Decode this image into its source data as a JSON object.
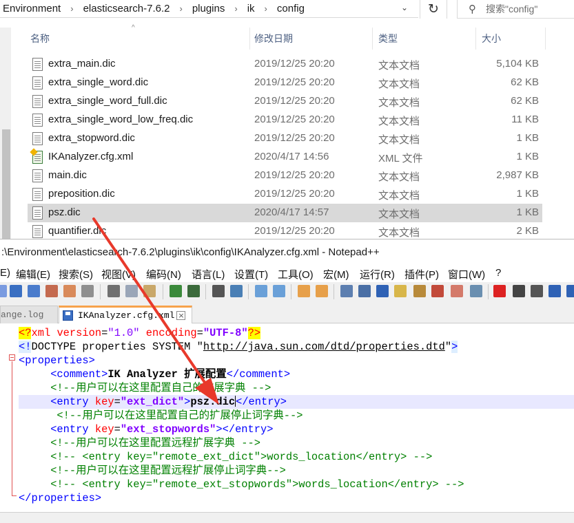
{
  "explorer": {
    "breadcrumbs": [
      "Environment",
      "elasticsearch-7.6.2",
      "plugins",
      "ik",
      "config"
    ],
    "search_placeholder": "搜索\"config\"",
    "columns": {
      "name": "名称",
      "date": "修改日期",
      "type": "类型",
      "size": "大小"
    },
    "files": [
      {
        "name": "extra_main.dic",
        "date": "2019/12/25 20:20",
        "type": "文本文档",
        "size": "5,104 KB",
        "icon": "text-file-icon"
      },
      {
        "name": "extra_single_word.dic",
        "date": "2019/12/25 20:20",
        "type": "文本文档",
        "size": "62 KB",
        "icon": "text-file-icon"
      },
      {
        "name": "extra_single_word_full.dic",
        "date": "2019/12/25 20:20",
        "type": "文本文档",
        "size": "62 KB",
        "icon": "text-file-icon"
      },
      {
        "name": "extra_single_word_low_freq.dic",
        "date": "2019/12/25 20:20",
        "type": "文本文档",
        "size": "11 KB",
        "icon": "text-file-icon"
      },
      {
        "name": "extra_stopword.dic",
        "date": "2019/12/25 20:20",
        "type": "文本文档",
        "size": "1 KB",
        "icon": "text-file-icon"
      },
      {
        "name": "IKAnalyzer.cfg.xml",
        "date": "2020/4/17 14:56",
        "type": "XML 文件",
        "size": "1 KB",
        "icon": "xml-file-icon"
      },
      {
        "name": "main.dic",
        "date": "2019/12/25 20:20",
        "type": "文本文档",
        "size": "2,987 KB",
        "icon": "text-file-icon"
      },
      {
        "name": "preposition.dic",
        "date": "2019/12/25 20:20",
        "type": "文本文档",
        "size": "1 KB",
        "icon": "text-file-icon"
      },
      {
        "name": "psz.dic",
        "date": "2020/4/17 14:57",
        "type": "文本文档",
        "size": "1 KB",
        "icon": "text-file-icon",
        "selected": true
      },
      {
        "name": "quantifier.dic",
        "date": "2019/12/25 20:20",
        "type": "文本文档",
        "size": "2 KB",
        "icon": "text-file-icon"
      }
    ]
  },
  "npp": {
    "title": ":\\Environment\\elasticsearch-7.6.2\\plugins\\ik\\config\\IKAnalyzer.cfg.xml - Notepad++",
    "menu": [
      "E)",
      "编辑(E)",
      "搜索(S)",
      "视图(V)",
      "编码(N)",
      "语言(L)",
      "设置(T)",
      "工具(O)",
      "宏(M)",
      "运行(R)",
      "插件(P)",
      "窗口(W)",
      "?"
    ],
    "tabs": [
      {
        "label": "ange.log",
        "active": false
      },
      {
        "label": "IKAnalyzer.cfg.xml",
        "active": true
      }
    ],
    "code": {
      "l1": {
        "a": "<?",
        "b": "xml ",
        "c": "version",
        "d": "=",
        "e": "\"1.0\"",
        "f": " ",
        "g": "encoding",
        "h": "=",
        "i": "\"UTF-8\"",
        "j": "?>"
      },
      "l2": {
        "a": "<!",
        "b": "DOCTYPE properties SYSTEM \"",
        "c": "http://java.sun.com/dtd/properties.dtd",
        "d": "\"",
        "e": ">"
      },
      "l3": {
        "a": "<properties>"
      },
      "l4": {
        "indent": "     ",
        "a": "<comment>",
        "b": "IK Analyzer 扩展配置",
        "c": "</comment>"
      },
      "l5": {
        "indent": "     ",
        "a": "<!--用户可以在这里配置自己的扩展字典 -->"
      },
      "l6": {
        "indent": "     ",
        "a": "<entry ",
        "b": "key",
        "c": "=",
        "d": "\"ext_dict\"",
        "e": ">",
        "f": "psz.dic",
        "g": "</entry>"
      },
      "l7": {
        "indent": "      ",
        "a": "<!--用户可以在这里配置自己的扩展停止词字典-->"
      },
      "l8": {
        "indent": "     ",
        "a": "<entry ",
        "b": "key",
        "c": "=",
        "d": "\"ext_stopwords\"",
        "e": "></entry>"
      },
      "l9": {
        "indent": "     ",
        "a": "<!--用户可以在这里配置远程扩展字典 -->"
      },
      "l10": {
        "indent": "     ",
        "a": "<!-- <entry key=\"remote_ext_dict\">words_location</entry> -->"
      },
      "l11": {
        "indent": "     ",
        "a": "<!--用户可以在这里配置远程扩展停止词字典-->"
      },
      "l12": {
        "indent": "     ",
        "a": "<!-- <entry key=\"remote_ext_stopwords\">words_location</entry> -->"
      },
      "l13": {
        "a": "</properties>"
      }
    }
  },
  "colors": {
    "annotation_arrow": "#e8392b",
    "current_line": "#e8e8ff",
    "selection": "#d9d9d9"
  }
}
